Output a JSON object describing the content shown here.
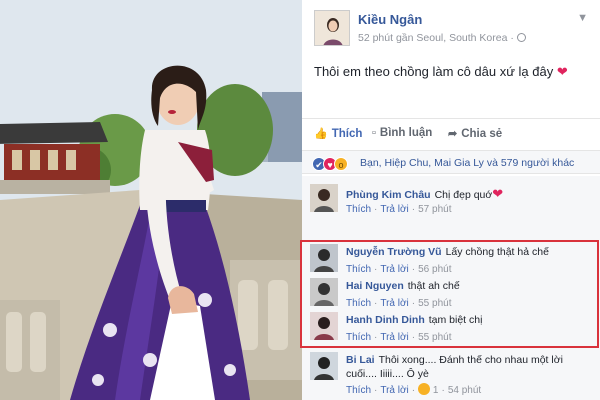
{
  "post": {
    "author": "Kiều Ngân",
    "meta": "52 phút gần Seoul, South Korea ·",
    "menu_icon": "chevron-down-icon",
    "text": "Thôi em theo chồng làm cô dâu xứ lạ đây",
    "emoji": "❤"
  },
  "actions": {
    "like": "Thích",
    "comment": "Bình luận",
    "share": "Chia sẻ"
  },
  "reactions": {
    "summary": "Bạn, Hiệp Chu, Mai Gia Ly và 579 người khác"
  },
  "comment_labels": {
    "like": "Thích",
    "reply": "Trả lời",
    "separator": "·"
  },
  "comments": [
    {
      "name": "Phùng Kim Châu",
      "text": "Chị đẹp quớ",
      "emoji": "❤",
      "time": "57 phút"
    },
    {
      "name": "Nguyễn Trường Vũ",
      "text": "Lấy chồng thật hả chế",
      "time": "56 phút"
    },
    {
      "name": "Hai Nguyen",
      "text": "thật ah chế",
      "time": "55 phút"
    },
    {
      "name": "Hanh Dinh Dinh",
      "text": "tạm biệt chị",
      "time": "55 phút"
    },
    {
      "name": "Bi Lai",
      "text": "Thôi xong.... Đánh thế cho nhau một lời",
      "text2": "cuối.... Iiiii.... Ô yè",
      "time": "54 phút",
      "likes": "1"
    }
  ],
  "colors": {
    "link": "#365899",
    "accent": "#4267b2",
    "highlight": "#d9323c",
    "heart": "#e0245e"
  }
}
